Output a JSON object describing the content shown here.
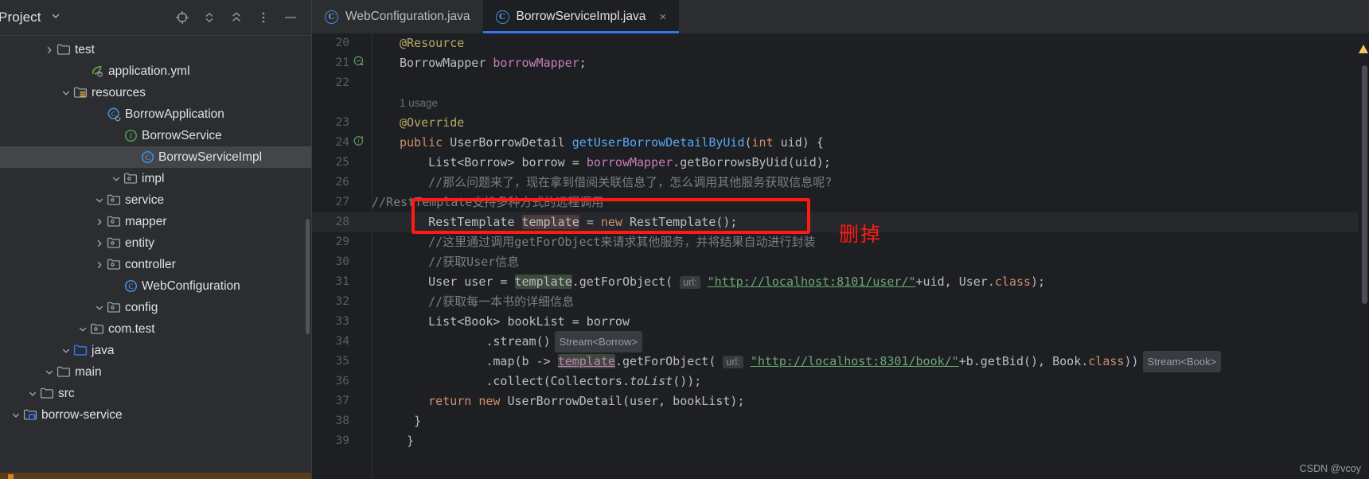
{
  "project_panel": {
    "title": "Project",
    "title_chevron": "chevron-down",
    "header_actions": [
      {
        "name": "locate-icon",
        "label": "Select Opened File"
      },
      {
        "name": "expand-collapse-icon",
        "label": "Expand/Collapse"
      },
      {
        "name": "collapse-all-icon",
        "label": "Collapse All"
      },
      {
        "name": "more-options-icon",
        "label": "More Options"
      },
      {
        "name": "hide-icon",
        "label": "Hide"
      }
    ],
    "tree": [
      {
        "label": "borrow-service",
        "depth": 0,
        "twisty": "down",
        "icon": "module-folder-icon",
        "selected": false
      },
      {
        "label": "src",
        "depth": 1,
        "twisty": "down",
        "icon": "folder-icon",
        "selected": false
      },
      {
        "label": "main",
        "depth": 2,
        "twisty": "down",
        "icon": "folder-icon",
        "selected": false
      },
      {
        "label": "java",
        "depth": 3,
        "twisty": "down",
        "icon": "source-folder-icon",
        "selected": false
      },
      {
        "label": "com.test",
        "depth": 4,
        "twisty": "down",
        "icon": "package-icon",
        "selected": false
      },
      {
        "label": "config",
        "depth": 5,
        "twisty": "down",
        "icon": "package-icon",
        "selected": false
      },
      {
        "label": "WebConfiguration",
        "depth": 6,
        "twisty": "none",
        "icon": "java-class-icon",
        "selected": false
      },
      {
        "label": "controller",
        "depth": 5,
        "twisty": "right",
        "icon": "package-icon",
        "selected": false
      },
      {
        "label": "entity",
        "depth": 5,
        "twisty": "right",
        "icon": "package-icon",
        "selected": false
      },
      {
        "label": "mapper",
        "depth": 5,
        "twisty": "right",
        "icon": "package-icon",
        "selected": false
      },
      {
        "label": "service",
        "depth": 5,
        "twisty": "down",
        "icon": "package-icon",
        "selected": false
      },
      {
        "label": "impl",
        "depth": 6,
        "twisty": "down",
        "icon": "package-icon",
        "selected": false
      },
      {
        "label": "BorrowServiceImpl",
        "depth": 7,
        "twisty": "none",
        "icon": "java-class-icon",
        "selected": true
      },
      {
        "label": "BorrowService",
        "depth": 6,
        "twisty": "none",
        "icon": "java-interface-icon",
        "selected": false
      },
      {
        "label": "BorrowApplication",
        "depth": 5,
        "twisty": "none",
        "icon": "spring-boot-class-icon",
        "selected": false
      },
      {
        "label": "resources",
        "depth": 3,
        "twisty": "down",
        "icon": "resources-folder-icon",
        "selected": false
      },
      {
        "label": "application.yml",
        "depth": 4,
        "twisty": "none",
        "icon": "spring-yaml-icon",
        "selected": false
      },
      {
        "label": "test",
        "depth": 2,
        "twisty": "right",
        "icon": "folder-icon",
        "selected": false
      }
    ]
  },
  "editor": {
    "tabs": [
      {
        "label": "WebConfiguration.java",
        "icon": "java-class-icon",
        "active": false,
        "closable": false
      },
      {
        "label": "BorrowServiceImpl.java",
        "icon": "java-class-icon",
        "active": true,
        "closable": true
      }
    ],
    "close_glyph": "×",
    "inlay_usage": "1 usage",
    "lines": [
      {
        "n": "20",
        "text": "@Resource"
      },
      {
        "n": "21",
        "text": "BorrowMapper borrowMapper;",
        "mark": "implementing-method-icon"
      },
      {
        "n": "22",
        "text": ""
      },
      {
        "n": "23",
        "text": "@Override"
      },
      {
        "n": "24",
        "text": "public UserBorrowDetail getUserBorrowDetailByUid(int uid) {",
        "mark": "implementing-interface-icon"
      },
      {
        "n": "25",
        "text": "    List<Borrow> borrow = borrowMapper.getBorrowsByUid(uid);"
      },
      {
        "n": "26",
        "text": "    //那么问题来了，现在拿到借阅关联信息了，怎么调用其他服务获取信息呢?"
      },
      {
        "n": "27",
        "text": "//RestTemplate支持多种方式的远程调用"
      },
      {
        "n": "28",
        "text": "    RestTemplate template = new RestTemplate();"
      },
      {
        "n": "29",
        "text": "    //这里通过调用getForObject来请求其他服务，并将结果自动进行封装"
      },
      {
        "n": "30",
        "text": "    //获取User信息"
      },
      {
        "n": "31",
        "text": "    User user = template.getForObject( url: \"http://localhost:8101/user/\"+uid, User.class);"
      },
      {
        "n": "32",
        "text": "    //获取每一本书的详细信息"
      },
      {
        "n": "33",
        "text": "    List<Book> bookList = borrow"
      },
      {
        "n": "34",
        "text": "            .stream()",
        "inlay": "Stream<Borrow>"
      },
      {
        "n": "35",
        "text": "            .map(b -> template.getForObject( url: \"http://localhost:8301/book/\"+b.getBid(), Book.class))",
        "inlay": "Stream<Book>"
      },
      {
        "n": "36",
        "text": "            .collect(Collectors.toList());"
      },
      {
        "n": "37",
        "text": "    return new UserBorrowDetail(user, bookList);"
      },
      {
        "n": "38",
        "text": "  }"
      },
      {
        "n": "39",
        "text": " }"
      }
    ],
    "param_hint_url": "url:",
    "annotation": {
      "text": "删掉",
      "color": "#ff1a12"
    }
  },
  "watermark": "CSDN @vcoy"
}
